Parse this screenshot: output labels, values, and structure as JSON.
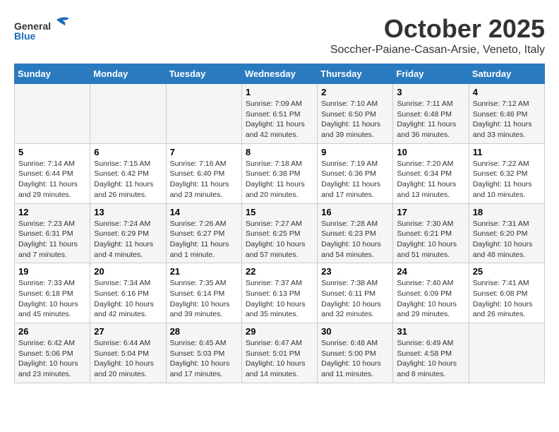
{
  "header": {
    "logo_general": "General",
    "logo_blue": "Blue",
    "month": "October 2025",
    "location": "Soccher-Paiane-Casan-Arsie, Veneto, Italy"
  },
  "days_of_week": [
    "Sunday",
    "Monday",
    "Tuesday",
    "Wednesday",
    "Thursday",
    "Friday",
    "Saturday"
  ],
  "weeks": [
    [
      {
        "day": "",
        "content": ""
      },
      {
        "day": "",
        "content": ""
      },
      {
        "day": "",
        "content": ""
      },
      {
        "day": "1",
        "content": "Sunrise: 7:09 AM\nSunset: 6:51 PM\nDaylight: 11 hours and 42 minutes."
      },
      {
        "day": "2",
        "content": "Sunrise: 7:10 AM\nSunset: 6:50 PM\nDaylight: 11 hours and 39 minutes."
      },
      {
        "day": "3",
        "content": "Sunrise: 7:11 AM\nSunset: 6:48 PM\nDaylight: 11 hours and 36 minutes."
      },
      {
        "day": "4",
        "content": "Sunrise: 7:12 AM\nSunset: 6:46 PM\nDaylight: 11 hours and 33 minutes."
      }
    ],
    [
      {
        "day": "5",
        "content": "Sunrise: 7:14 AM\nSunset: 6:44 PM\nDaylight: 11 hours and 29 minutes."
      },
      {
        "day": "6",
        "content": "Sunrise: 7:15 AM\nSunset: 6:42 PM\nDaylight: 11 hours and 26 minutes."
      },
      {
        "day": "7",
        "content": "Sunrise: 7:16 AM\nSunset: 6:40 PM\nDaylight: 11 hours and 23 minutes."
      },
      {
        "day": "8",
        "content": "Sunrise: 7:18 AM\nSunset: 6:38 PM\nDaylight: 11 hours and 20 minutes."
      },
      {
        "day": "9",
        "content": "Sunrise: 7:19 AM\nSunset: 6:36 PM\nDaylight: 11 hours and 17 minutes."
      },
      {
        "day": "10",
        "content": "Sunrise: 7:20 AM\nSunset: 6:34 PM\nDaylight: 11 hours and 13 minutes."
      },
      {
        "day": "11",
        "content": "Sunrise: 7:22 AM\nSunset: 6:32 PM\nDaylight: 11 hours and 10 minutes."
      }
    ],
    [
      {
        "day": "12",
        "content": "Sunrise: 7:23 AM\nSunset: 6:31 PM\nDaylight: 11 hours and 7 minutes."
      },
      {
        "day": "13",
        "content": "Sunrise: 7:24 AM\nSunset: 6:29 PM\nDaylight: 11 hours and 4 minutes."
      },
      {
        "day": "14",
        "content": "Sunrise: 7:26 AM\nSunset: 6:27 PM\nDaylight: 11 hours and 1 minute."
      },
      {
        "day": "15",
        "content": "Sunrise: 7:27 AM\nSunset: 6:25 PM\nDaylight: 10 hours and 57 minutes."
      },
      {
        "day": "16",
        "content": "Sunrise: 7:28 AM\nSunset: 6:23 PM\nDaylight: 10 hours and 54 minutes."
      },
      {
        "day": "17",
        "content": "Sunrise: 7:30 AM\nSunset: 6:21 PM\nDaylight: 10 hours and 51 minutes."
      },
      {
        "day": "18",
        "content": "Sunrise: 7:31 AM\nSunset: 6:20 PM\nDaylight: 10 hours and 48 minutes."
      }
    ],
    [
      {
        "day": "19",
        "content": "Sunrise: 7:33 AM\nSunset: 6:18 PM\nDaylight: 10 hours and 45 minutes."
      },
      {
        "day": "20",
        "content": "Sunrise: 7:34 AM\nSunset: 6:16 PM\nDaylight: 10 hours and 42 minutes."
      },
      {
        "day": "21",
        "content": "Sunrise: 7:35 AM\nSunset: 6:14 PM\nDaylight: 10 hours and 39 minutes."
      },
      {
        "day": "22",
        "content": "Sunrise: 7:37 AM\nSunset: 6:13 PM\nDaylight: 10 hours and 35 minutes."
      },
      {
        "day": "23",
        "content": "Sunrise: 7:38 AM\nSunset: 6:11 PM\nDaylight: 10 hours and 32 minutes."
      },
      {
        "day": "24",
        "content": "Sunrise: 7:40 AM\nSunset: 6:09 PM\nDaylight: 10 hours and 29 minutes."
      },
      {
        "day": "25",
        "content": "Sunrise: 7:41 AM\nSunset: 6:08 PM\nDaylight: 10 hours and 26 minutes."
      }
    ],
    [
      {
        "day": "26",
        "content": "Sunrise: 6:42 AM\nSunset: 5:06 PM\nDaylight: 10 hours and 23 minutes."
      },
      {
        "day": "27",
        "content": "Sunrise: 6:44 AM\nSunset: 5:04 PM\nDaylight: 10 hours and 20 minutes."
      },
      {
        "day": "28",
        "content": "Sunrise: 6:45 AM\nSunset: 5:03 PM\nDaylight: 10 hours and 17 minutes."
      },
      {
        "day": "29",
        "content": "Sunrise: 6:47 AM\nSunset: 5:01 PM\nDaylight: 10 hours and 14 minutes."
      },
      {
        "day": "30",
        "content": "Sunrise: 6:48 AM\nSunset: 5:00 PM\nDaylight: 10 hours and 11 minutes."
      },
      {
        "day": "31",
        "content": "Sunrise: 6:49 AM\nSunset: 4:58 PM\nDaylight: 10 hours and 8 minutes."
      },
      {
        "day": "",
        "content": ""
      }
    ]
  ]
}
